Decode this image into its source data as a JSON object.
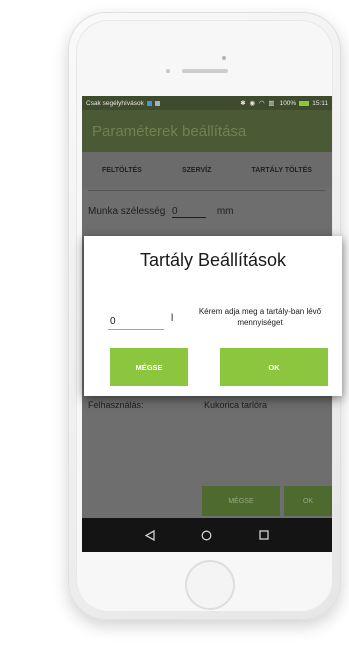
{
  "status_bar": {
    "carrier": "Csak segélyhívások",
    "battery": "100%",
    "time": "15:11",
    "icon_names": [
      "bluetooth-icon",
      "alarm-icon",
      "wifi-icon",
      "signal-icon",
      "battery-icon"
    ]
  },
  "app_bar": {
    "title": "Paraméterek beállítása"
  },
  "tabs": [
    {
      "label": "FELTÖLTÉS"
    },
    {
      "label": "SZERVÍZ"
    },
    {
      "label": "TARTÁLY TÖLTÉS"
    }
  ],
  "form": {
    "munka_label": "Munka szélesség",
    "munka_value": "0",
    "munka_unit": "mm",
    "felhasznalas_label": "Felhasználás:",
    "felhasznalas_value": "Kukorica tarlóra"
  },
  "bottom_buttons": {
    "cancel": "MÉGSE",
    "ok": "OK"
  },
  "dialog": {
    "title": "Tartály Beállítások",
    "input_value": "0",
    "unit": "l",
    "message": "Kérem adja meg a tartály-ban lévő mennyiséget",
    "cancel_label": "MÉGSE",
    "ok_label": "OK"
  },
  "colors": {
    "accent": "#8cc63f",
    "app_bar": "#495a34",
    "status_bar": "#3f4b2d"
  }
}
